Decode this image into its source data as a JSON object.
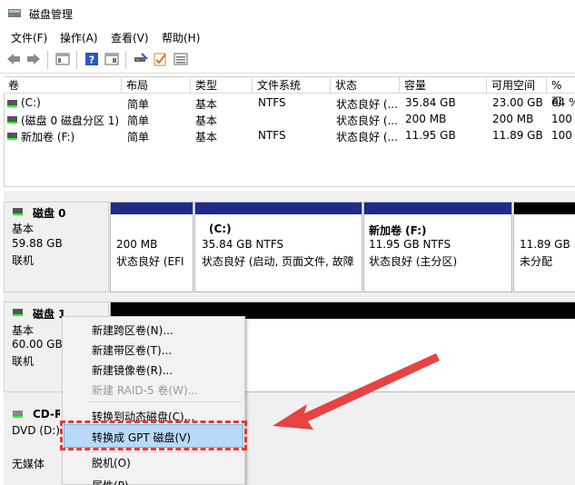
{
  "window": {
    "title": "磁盘管理"
  },
  "menu": [
    "文件(F)",
    "操作(A)",
    "查看(V)",
    "帮助(H)"
  ],
  "table": {
    "headers": [
      "卷",
      "布局",
      "类型",
      "文件系统",
      "状态",
      "容量",
      "可用空间",
      "% 可"
    ],
    "rows": [
      [
        "(C:)",
        "简单",
        "基本",
        "NTFS",
        "状态良好 (...",
        "35.84 GB",
        "23.00 GB",
        "64 %"
      ],
      [
        "(磁盘 0 磁盘分区 1)",
        "简单",
        "基本",
        "",
        "状态良好 (...",
        "200 MB",
        "200 MB",
        "100"
      ],
      [
        "新加卷 (F:)",
        "简单",
        "基本",
        "NTFS",
        "状态良好 (...",
        "11.95 GB",
        "11.89 GB",
        "100"
      ]
    ]
  },
  "disk0": {
    "title": "磁盘 0",
    "type": "基本",
    "size": "59.88 GB",
    "status": "联机",
    "partitions": [
      {
        "name": "",
        "size": "200 MB",
        "status": "状态良好 (EFI"
      },
      {
        "name": "(C:)",
        "size": "35.84 GB NTFS",
        "status": "状态良好 (启动, 页面文件, 故障"
      },
      {
        "name": "新加卷  (F:)",
        "size": "11.95 GB NTFS",
        "status": "状态良好 (主分区)"
      },
      {
        "name": "",
        "size": "11.89 GB",
        "status": "未分配"
      }
    ]
  },
  "disk1": {
    "title": "磁盘 1",
    "type": "基本",
    "size": "60.00 GB",
    "status": "联机"
  },
  "cdrom": {
    "title": "CD-R",
    "drive": "DVD (D:)",
    "status": "无媒体"
  },
  "context_menu": {
    "items": [
      "新建跨区卷(N)...",
      "新建带区卷(T)...",
      "新建镜像卷(R)...",
      "新建 RAID-5 卷(W)...",
      "转换到动态磁盘(C)...",
      "转换成 GPT 磁盘(V)",
      "脱机(O)",
      "属性(P)"
    ],
    "disabled_index": 3,
    "highlighted_index": 5
  },
  "colors": {
    "partition_bar": "#1e2c8a",
    "unallocated_bar": "#000000",
    "arrow": "#e53939",
    "highlight": "#b9d9f6"
  }
}
